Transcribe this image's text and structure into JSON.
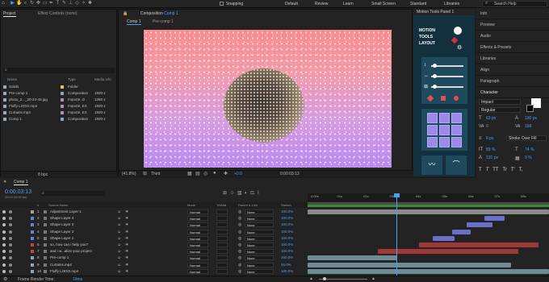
{
  "toolbar": {
    "snapping": "Snapping",
    "workspaces": [
      "Default",
      "Review",
      "Learn",
      "Small Screen",
      "Standard",
      "Libraries"
    ],
    "search_placeholder": "Search Help"
  },
  "project": {
    "tabs": [
      "Project",
      "Effect Controls (none)"
    ],
    "search_placeholder": "⌕",
    "headers": {
      "name": "Name",
      "type": "Type",
      "size": "Media info"
    },
    "items": [
      {
        "name": "Solids",
        "type": "Folder",
        "size": "",
        "color": "#e8c25a"
      },
      {
        "name": "Pre-comp 1",
        "type": "Composition",
        "size": "1920 x",
        "color": "#8fa7b8"
      },
      {
        "name": "photo_2..._20-24-45.jpg",
        "type": "Importe..G",
        "size": "1280 x",
        "color": "#b88ab8"
      },
      {
        "name": "Fluffy LOGO.mp4",
        "type": "Importe..EX",
        "size": "1920 x",
        "color": "#b88ab8"
      },
      {
        "name": "Curtains.mp4",
        "type": "Importe..EX",
        "size": "1920 x",
        "color": "#b88ab8"
      },
      {
        "name": "Comp 1",
        "type": "Composition",
        "size": "1920 x",
        "color": "#8fa7b8"
      }
    ],
    "footer": "8 bpc"
  },
  "comp": {
    "tab_prefix": "Composition",
    "name": "Comp 1",
    "subtab": "Comp 1",
    "breadcrumb": "Pre-comp 1",
    "zoom": "(41.8%)",
    "quality": "Third",
    "exposure": "+0.0",
    "timecode": "0:00:03:13"
  },
  "motion_tools": {
    "tab": "Motion Tools Panel 1",
    "title": [
      "MOTION",
      "TOOLS",
      "LAYOUT"
    ]
  },
  "right_panels": [
    "Info",
    "Preview",
    "Audio",
    "Effects & Presets",
    "Libraries",
    "Align",
    "Paragraph",
    "Character"
  ],
  "character": {
    "font": "Impact",
    "style": "Regular",
    "size": "63 px",
    "leading": "190 px",
    "kerning": "0",
    "tracking": "168",
    "stroke_width": "6 px",
    "stroke_type": "Stroke Over Fill",
    "vscale": "89 %",
    "hscale": "74 %",
    "baseline": "131 px",
    "tsume": "0 %",
    "styles": [
      "T",
      "T",
      "TT",
      "Tr",
      "T'",
      "T,"
    ]
  },
  "timeline": {
    "tab": "Comp 1",
    "timecode": "0:00:03:13",
    "fps": "00103 (30.00 fps)",
    "cols": {
      "num": "#",
      "source": "Source Name",
      "mode": "Mode",
      "trkmat": "TrkMat",
      "parent": "Parent & Link",
      "stretch": "Stretch"
    },
    "layers": [
      {
        "num": "1",
        "name": "Adjustment Layer 1",
        "color": "#a0a0a0",
        "mode": "Normal",
        "parent": "None",
        "stretch": "100.0%"
      },
      {
        "num": "2",
        "name": "Shape Layer 4",
        "color": "#6a7fd8",
        "mode": "Normal",
        "parent": "None",
        "stretch": "100.0%"
      },
      {
        "num": "3",
        "name": "Shape Layer 3",
        "color": "#6a7fd8",
        "mode": "Normal",
        "parent": "None",
        "stretch": "100.0%"
      },
      {
        "num": "4",
        "name": "Shape Layer 2",
        "color": "#6a7fd8",
        "mode": "Normal",
        "parent": "None",
        "stretch": "100.0%"
      },
      {
        "num": "5",
        "name": "Shape Layer 1",
        "color": "#6a7fd8",
        "mode": "Normal",
        "parent": "None",
        "stretch": "100.0%"
      },
      {
        "num": "6",
        "name": "so, how can i help you?",
        "color": "#c84040",
        "mode": "Normal",
        "parent": "None",
        "stretch": "100.0%"
      },
      {
        "num": "7",
        "name": "and i w...alize your project",
        "color": "#c84040",
        "mode": "Normal",
        "parent": "None",
        "stretch": "100.0%"
      },
      {
        "num": "8",
        "name": "Pre-comp 1",
        "color": "#8fa7b8",
        "mode": "Normal",
        "parent": "None",
        "stretch": "100.0%"
      },
      {
        "num": "9",
        "name": "Curtains.mp4",
        "color": "#8fa7b8",
        "mode": "Normal",
        "parent": "None",
        "stretch": "25.0%"
      },
      {
        "num": "10",
        "name": "Fluffy LOGO.mp4",
        "color": "#8fa7b8",
        "mode": "Normal",
        "parent": "None",
        "stretch": "100.0%"
      }
    ],
    "ruler": [
      "0:00s",
      "01s",
      "02s",
      "03s",
      "04s",
      "05s",
      "06s",
      "07s",
      "08s"
    ],
    "footer_label": "Frame Render Time:",
    "footer_value": "19ms"
  }
}
